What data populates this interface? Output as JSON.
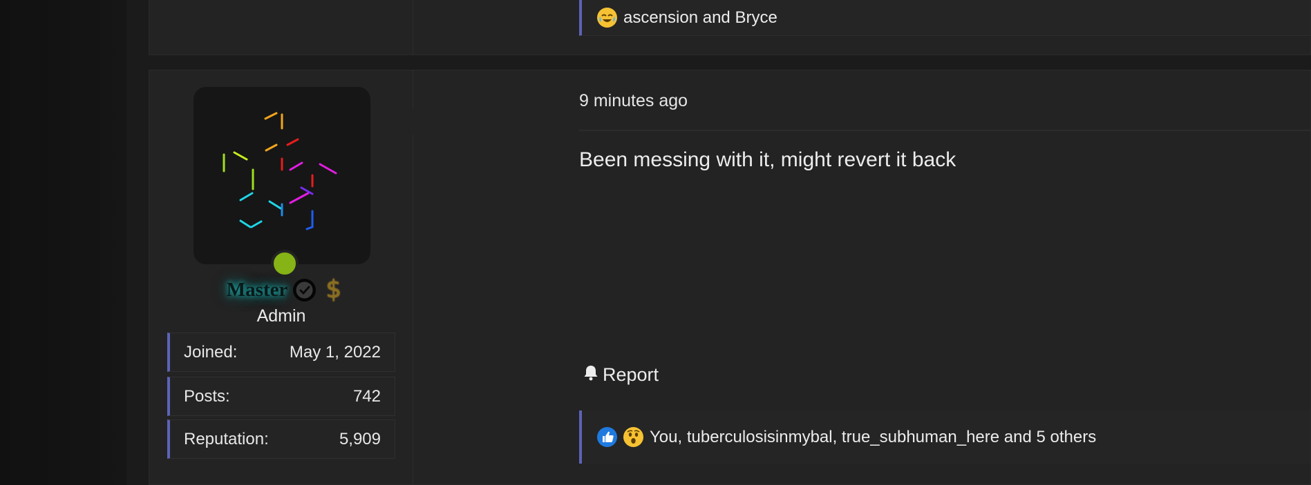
{
  "previous_post": {
    "reactions_text": "ascension and Bryce",
    "reaction_icons": [
      "laugh-cry-icon"
    ]
  },
  "post": {
    "timestamp": "9 minutes ago",
    "content": "Been messing with it, might revert it back",
    "report_label": "Report",
    "reactions_text": "You, tuberculosisinmybal, true_subhuman_here and 5 others",
    "reaction_icons": [
      "like-icon",
      "wow-icon"
    ]
  },
  "author": {
    "username": "Master",
    "role": "Admin",
    "online": true,
    "badges": [
      "verified-icon",
      "dollar-icon"
    ],
    "stats": [
      {
        "label": "Joined:",
        "value": "May 1, 2022"
      },
      {
        "label": "Posts:",
        "value": "742"
      },
      {
        "label": "Reputation:",
        "value": "5,909"
      }
    ]
  },
  "colors": {
    "accent": "#5d63b8",
    "online": "#86b416",
    "username_glow": "#1fb7b7",
    "background": "#232323"
  }
}
